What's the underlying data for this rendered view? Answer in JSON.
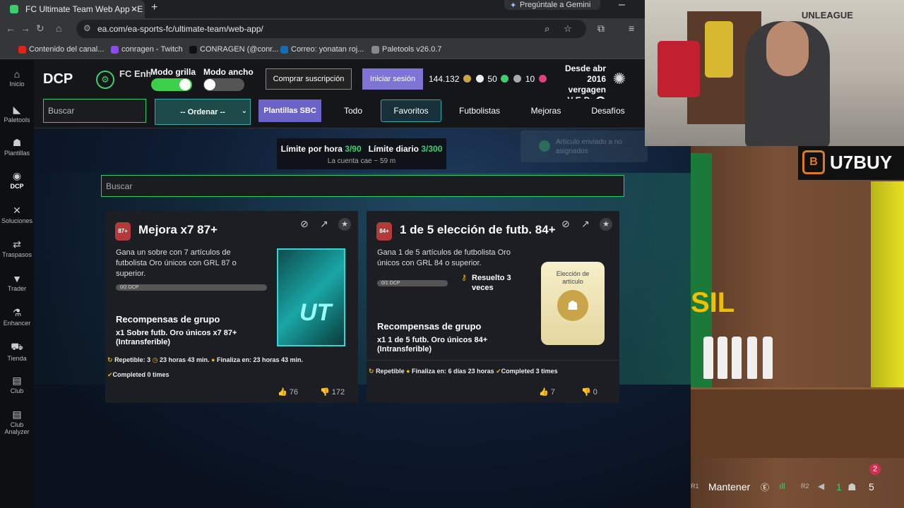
{
  "browser": {
    "tab_title": "FC Ultimate Team Web App - E",
    "gemini_label": "Pregúntale a Gemini",
    "url": "ea.com/ea-sports-fc/ultimate-team/web-app/",
    "bookmarks": [
      {
        "label": "Contenido del canal...",
        "color": "#e62117"
      },
      {
        "label": "conragen - Twitch",
        "color": "#9146ff"
      },
      {
        "label": "CONRAGEN (@conr...",
        "color": "#111111"
      },
      {
        "label": "Correo: yonatan roj...",
        "color": "#0f6cbd"
      },
      {
        "label": "Paletools v26.0.7",
        "color": "#888888"
      }
    ]
  },
  "sidebar": {
    "items": [
      {
        "label": "Inicio",
        "icon": "home-icon"
      },
      {
        "label": "Paletools",
        "icon": "palette-icon"
      },
      {
        "label": "Plantillas",
        "icon": "users-icon"
      },
      {
        "label": "DCP",
        "icon": "dcp-icon"
      },
      {
        "label": "Soluciones",
        "icon": "tools-icon"
      },
      {
        "label": "Traspasos",
        "icon": "transfer-icon"
      },
      {
        "label": "Trader",
        "icon": "shirt-icon"
      },
      {
        "label": "Enhancer",
        "icon": "flask-icon"
      },
      {
        "label": "Tienda",
        "icon": "cart-icon"
      },
      {
        "label": "Club",
        "icon": "club-icon"
      },
      {
        "label": "Club Analyzer",
        "icon": "analyzer-icon"
      }
    ]
  },
  "header": {
    "title": "DCP",
    "brand": "FC Enhancer",
    "grid_mode_label": "Modo grilla",
    "grid_mode_on": true,
    "wide_mode_label": "Modo ancho",
    "wide_mode_on": false,
    "buy_subscription": "Comprar suscripción",
    "login": "Iniciar sesión",
    "coins": "144.132",
    "points": "50",
    "tokens": "10",
    "user_since": "Desde abr 2016",
    "username": "vergagen",
    "record": "V-E-D:"
  },
  "filters": {
    "search_placeholder": "Buscar",
    "order_label": "-- Ordenar --",
    "chips": [
      "Plantillas SBC",
      "Todo",
      "Favoritos",
      "Futbolistas",
      "Mejoras",
      "Desafíos"
    ]
  },
  "limits": {
    "hourly_label": "Límite por hora",
    "hourly_value": "3/90",
    "daily_label": "Límite diario",
    "daily_value": "3/300",
    "account_note": "La cuenta cae ~ 59 m"
  },
  "toast": "Artículo enviado a no asignados",
  "main_search_placeholder": "Buscar",
  "cards": [
    {
      "badge": "87+",
      "title": "Mejora x7 87+",
      "description_lines": [
        "Gana un sobre con 7 artículos de",
        "futbolista Oro únicos con GRL 87 o",
        "superior."
      ],
      "progress": "0/2 DCP",
      "progress_fraction": 0,
      "rewards_title": "Recompensas de grupo",
      "reward_lines": [
        "x1 Sobre futb. Oro únicos x7 87+",
        "(Intransferible)"
      ],
      "repeatable": "Repetible: 3",
      "timer": "23 horas 43 min.",
      "ends": "Finaliza en: 23 horas 43 min.",
      "completed": "Completed 0 times",
      "likes": "76",
      "dislikes": "172",
      "pack_text": "UT"
    },
    {
      "badge": "84+",
      "title": "1 de 5 elección de futb. 84+",
      "description_lines": [
        "Gana 1 de 5 artículos de futbolista Oro",
        "únicos con GRL 84 o superior."
      ],
      "progress": "0/1 DCP",
      "progress_fraction": 0,
      "solved_lines": [
        "Resuelto 3",
        "veces"
      ],
      "rewards_title": "Recompensas de grupo",
      "reward_lines": [
        "x1 1 de 5 futb. Oro únicos 84+",
        "(Intransferible)"
      ],
      "repeatable": "Repetible",
      "ends": "Finaliza en: 6 días 23 horas",
      "completed": "Completed 3 times",
      "likes": "7",
      "dislikes": "0",
      "pick_lines": [
        "Elección de",
        "artículo"
      ]
    }
  ],
  "stream": {
    "cam_logo": "UNLEAGUE",
    "sponsor": "U7BUY",
    "notification_count": "2",
    "hud_hold": "Mantener",
    "hud_r1": "R1",
    "hud_r2": "R2",
    "hud_count_green": "1",
    "hud_players": "5",
    "wall_text": "SIL"
  }
}
